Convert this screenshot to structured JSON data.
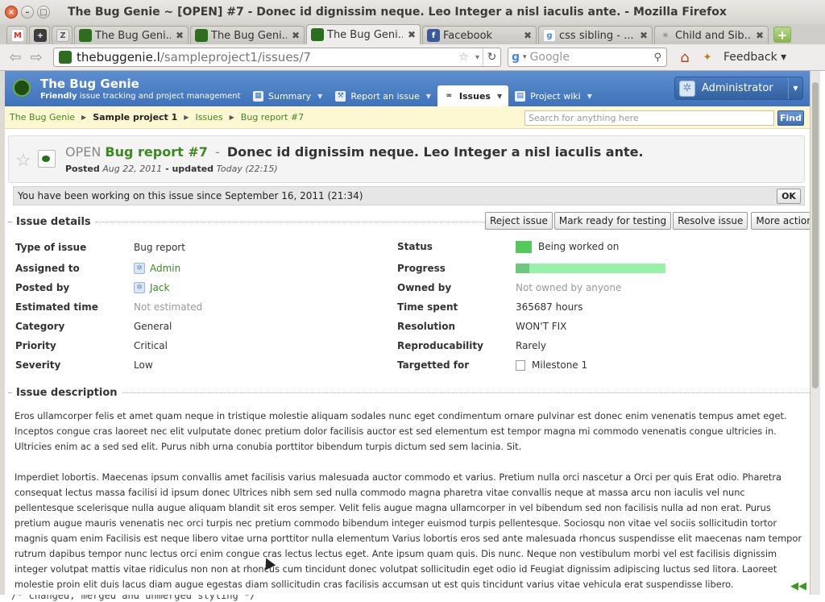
{
  "window": {
    "title": "The Bug Genie ~ [OPEN] #7 - Donec id dignissim neque. Leo Integer a nisl iaculis ante. - Mozilla Firefox"
  },
  "tabs": [
    {
      "label": "",
      "icon": "gmail-icon"
    },
    {
      "label": "",
      "icon": "plus-icon"
    },
    {
      "label": "Z",
      "icon": "z-icon"
    },
    {
      "label": "The Bug Geni...",
      "icon": "bug-genie-icon"
    },
    {
      "label": "The Bug Geni...",
      "icon": "bug-genie-icon"
    },
    {
      "label": "The Bug Geni...",
      "icon": "bug-genie-icon",
      "active": true
    },
    {
      "label": "Facebook",
      "icon": "facebook-icon"
    },
    {
      "label": "css sibling - ...",
      "icon": "google-icon"
    },
    {
      "label": "Child and Sib...",
      "icon": "star-icon"
    }
  ],
  "navbar": {
    "url_domain": "thebuggenie.l",
    "url_path": "/sampleproject1/issues/7",
    "search_placeholder": "Google",
    "search_engine_letter": "g",
    "feedback_label": "Feedback"
  },
  "app": {
    "logo_title": "The Bug Genie",
    "logo_sub_bold": "Friendly",
    "logo_sub_rest": " issue tracking and project management",
    "menu": [
      {
        "label": "Summary"
      },
      {
        "label": "Report an issue"
      },
      {
        "label": "Issues",
        "active": true
      },
      {
        "label": "Project wiki"
      }
    ],
    "user": "Administrator"
  },
  "breadcrumb": {
    "items": [
      "The Bug Genie",
      "Sample project 1",
      "Issues",
      "Bug report #7"
    ],
    "search_placeholder": "Search for anything here",
    "find_label": "Find"
  },
  "issue": {
    "state": "OPEN",
    "number": "Bug report #7",
    "dash": "-",
    "subject": "Donec id dignissim neque. Leo Integer a nisl iaculis ante.",
    "posted_label": "Posted",
    "posted_date": "Aug 22, 2011",
    "updated_label": " - updated",
    "updated_date": "Today (22:15)",
    "working_notice": "You have been working on this issue since September 16, 2011 (21:34)",
    "ok_label": "OK"
  },
  "details": {
    "heading": "Issue details",
    "actions": [
      "Reject issue",
      "Mark ready for testing",
      "Resolve issue",
      "More actions"
    ],
    "left": [
      {
        "label": "Type of issue",
        "value": "Bug report"
      },
      {
        "label": "Assigned to",
        "value": "Admin"
      },
      {
        "label": "Posted by",
        "value": "Jack"
      },
      {
        "label": "Estimated time",
        "value": "Not estimated"
      },
      {
        "label": "Category",
        "value": "General"
      },
      {
        "label": "Priority",
        "value": "Critical"
      },
      {
        "label": "Severity",
        "value": "Low"
      }
    ],
    "right": [
      {
        "label": "Status",
        "value": "Being worked on"
      },
      {
        "label": "Progress",
        "value": ""
      },
      {
        "label": "Owned by",
        "value": "Not owned by anyone"
      },
      {
        "label": "Time spent",
        "value": "365687 hours"
      },
      {
        "label": "Resolution",
        "value": "WON'T FIX"
      },
      {
        "label": "Reproducability",
        "value": "Rarely"
      },
      {
        "label": "Targetted for",
        "value": "Milestone 1"
      }
    ],
    "progress_fraction": 0.09,
    "status_color": "#52c95a"
  },
  "description": {
    "heading": "Issue description",
    "paragraphs": [
      "Eros ullamcorper felis et amet quam neque in tristique molestie aliquam sodales nunc eget condimentum ornare pulvinar est donec enim venenatis tempus amet eget. Inceptos congue cras laoreet nec elit vulputate donec pretium dolor facilisis auctor est sed elementum est tempor magna mi commodo venenatis congue ultricies in. Ultricies enim ac a sed sed elit. Purus nibh urna conubia porttitor bibendum turpis dictum sed sem lacinia. Sit.",
      "Imperdiet lobortis. Maecenas ipsum convallis amet facilisis varius malesuada auctor commodo et varius. Pretium nulla orci nascetur a Orci per quis Erat odio. Pharetra consequat lectus massa facilisi id ipsum donec Ultrices nibh sem sed nulla commodo magna pharetra vitae convallis neque at massa arcu non iaculis vel nunc pellentesque scelerisque nulla augue aliquam blandit sit eros semper. Velit felis augue magna ullamcorper in vel bibendum sed non facilisis nulla ad non erat. Purus pretium augue mauris venenatis nec orci turpis nec pretium commodo bibendum integer euismod turpis pellentesque. Sociosqu non vitae vel sociis sollicitudin tortor magnis quam enim Facilisis est neque libero vitae urna porttitor nulla elementum Varius lobortis eros sed ante malesuada rhoncus suspendisse elit maecenas nam tempor rutrum dapibus tempor nunc lectus orci enim congue cras lectus lectus eget. Ante ipsum quam quis. Dis nunc. Neque non vestibulum morbi vel est facilisis dignissim integer volutpat mattis vitae ridiculus non non at rhoncus cum tincidunt donec volutpat sollicitudin eget odio id Feugiat dignissim adipiscing luctus sed litora. Laoreet molestie proin elit duis lacus diam augue egestas diam sollicitudin cras facilisis accumsan ut est quis tincidunt varius vitae vehicula erat suspendisse libero."
    ]
  },
  "background_editor_line": "/* changed, merged and unmerged styling */"
}
